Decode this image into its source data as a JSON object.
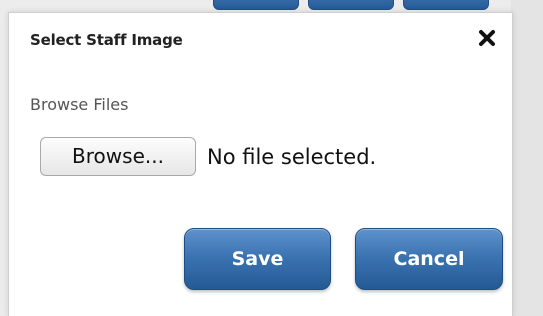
{
  "dialog": {
    "title": "Select Staff Image",
    "close_icon": "close-x-icon"
  },
  "file_field": {
    "label": "Browse Files",
    "browse_label": "Browse...",
    "status": "No file selected."
  },
  "actions": {
    "save_label": "Save",
    "cancel_label": "Cancel"
  },
  "colors": {
    "primary_button": "#3a72b0",
    "primary_button_border": "#1e4d80",
    "dialog_background": "#ffffff",
    "page_background": "#ececec"
  }
}
